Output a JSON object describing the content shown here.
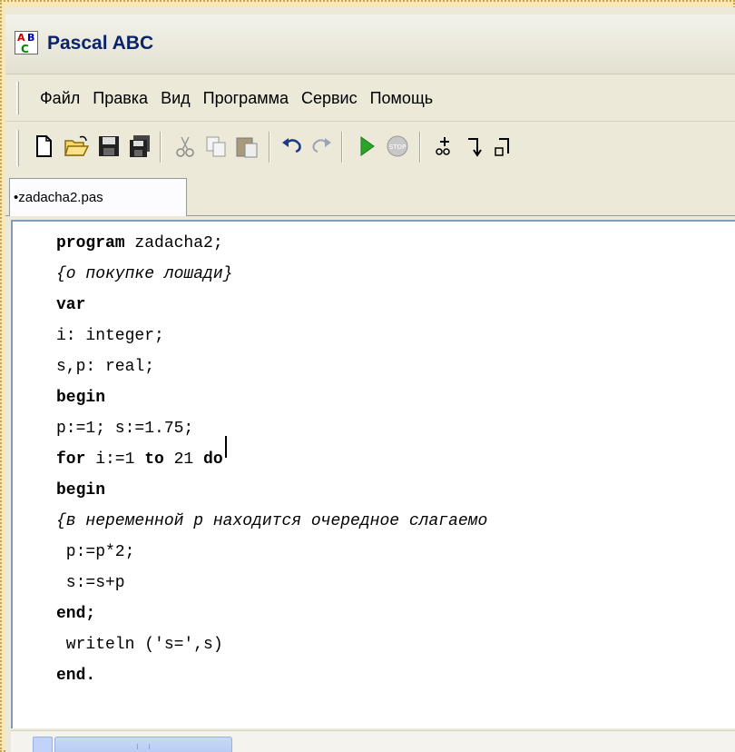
{
  "window": {
    "title": "Pascal ABC",
    "icon_text": [
      "A",
      "B",
      "C"
    ]
  },
  "menu": [
    "Файл",
    "Правка",
    "Вид",
    "Программа",
    "Сервис",
    "Помощь"
  ],
  "toolbar": {
    "icons": [
      "new-file-icon",
      "open-folder-icon",
      "save-icon",
      "save-all-icon",
      "cut-icon",
      "copy-icon",
      "paste-icon",
      "undo-icon",
      "redo-icon",
      "run-icon",
      "stop-icon",
      "step-over-icon",
      "step-into-icon",
      "step-out-icon"
    ]
  },
  "tab": {
    "label": "•zadacha2.pas"
  },
  "code": [
    {
      "segments": [
        {
          "t": "program",
          "s": "kw"
        },
        {
          "t": " zadacha2;",
          "s": ""
        }
      ]
    },
    {
      "segments": [
        {
          "t": "{о покупке лошади}",
          "s": "cm"
        }
      ]
    },
    {
      "segments": [
        {
          "t": "var",
          "s": "kw"
        }
      ]
    },
    {
      "segments": [
        {
          "t": "i: integer;",
          "s": ""
        }
      ]
    },
    {
      "segments": [
        {
          "t": "s,p: real;",
          "s": ""
        }
      ]
    },
    {
      "segments": [
        {
          "t": "begin",
          "s": "kw"
        }
      ]
    },
    {
      "segments": [
        {
          "t": "p:=1; s:=1.75;",
          "s": ""
        }
      ]
    },
    {
      "segments": [
        {
          "t": "for",
          "s": "kw"
        },
        {
          "t": " i:=1 ",
          "s": ""
        },
        {
          "t": "to",
          "s": "kw"
        },
        {
          "t": " 21 ",
          "s": ""
        },
        {
          "t": "do",
          "s": "kw"
        }
      ]
    },
    {
      "segments": [
        {
          "t": "begin",
          "s": "kw"
        }
      ]
    },
    {
      "segments": [
        {
          "t": "{в нeременной p находится очередное слагаемо",
          "s": "cm"
        }
      ]
    },
    {
      "segments": [
        {
          "t": " p:=p*2;",
          "s": ""
        }
      ]
    },
    {
      "segments": [
        {
          "t": " s:=s+p",
          "s": ""
        }
      ]
    },
    {
      "segments": [
        {
          "t": "end;",
          "s": "kw"
        }
      ]
    },
    {
      "segments": [
        {
          "t": " writeln ('s=',s)",
          "s": ""
        }
      ]
    },
    {
      "segments": [
        {
          "t": "end.",
          "s": "kw"
        }
      ]
    }
  ],
  "colors": {
    "title": "#0a246a",
    "run": "#2aa52a",
    "stop": "#c0392b"
  }
}
